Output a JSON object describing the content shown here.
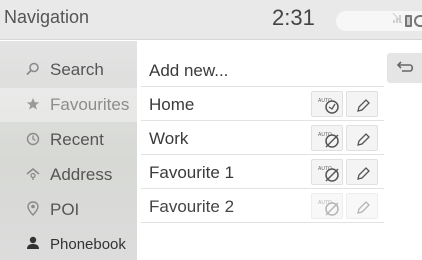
{
  "header": {
    "title": "Navigation",
    "time": "2:31"
  },
  "sidebar": {
    "items": [
      {
        "label": "Search",
        "icon": "search-icon",
        "active": false
      },
      {
        "label": "Favourites",
        "icon": "star-icon",
        "active": true
      },
      {
        "label": "Recent",
        "icon": "clock-icon",
        "active": false
      },
      {
        "label": "Address",
        "icon": "address-icon",
        "active": false
      },
      {
        "label": "POI",
        "icon": "poi-pin-icon",
        "active": false
      },
      {
        "label": "Phonebook",
        "icon": "person-icon",
        "active": false
      }
    ]
  },
  "main": {
    "add_label": "Add new...",
    "favourites": [
      {
        "label": "Home",
        "auto_enabled": true
      },
      {
        "label": "Work",
        "auto_enabled": false
      },
      {
        "label": "Favourite 1",
        "auto_enabled": false
      },
      {
        "label": "Favourite 2",
        "auto_enabled": false,
        "disabled": true
      }
    ],
    "auto_badge_text": "AUTO"
  },
  "colors": {
    "header_bg": "#e9e9e9",
    "sidebar_bg": "#dcdcdc",
    "text": "#3a3a3a"
  }
}
